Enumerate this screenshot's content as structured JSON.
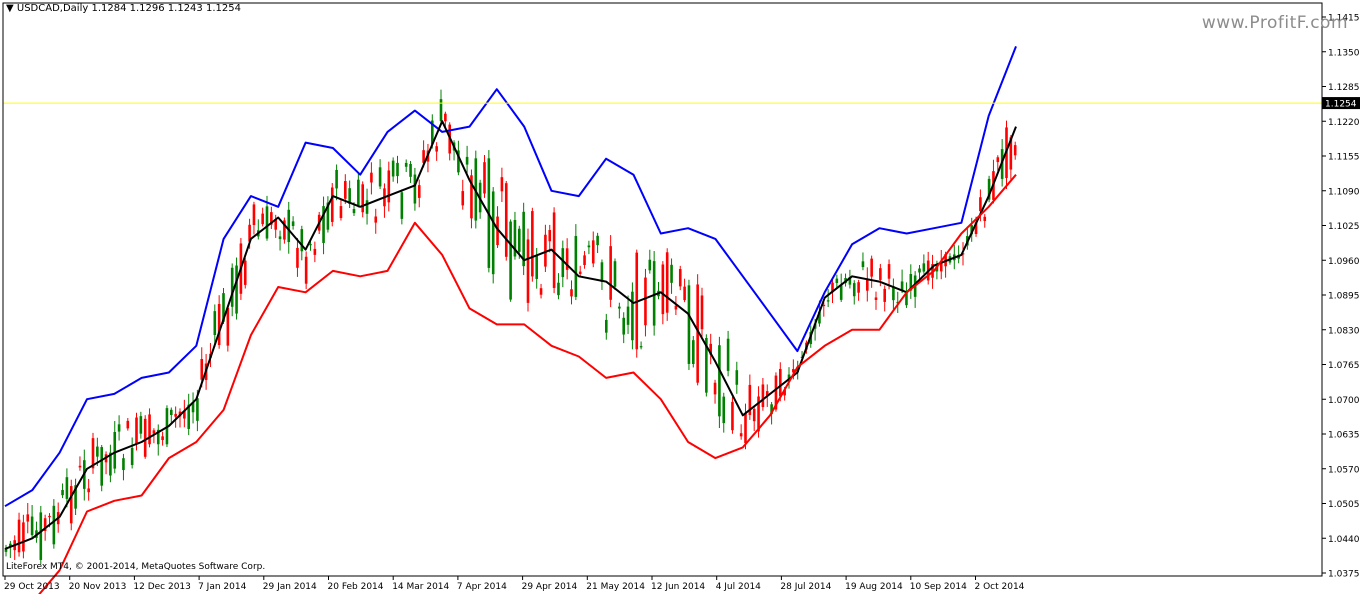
{
  "header": {
    "symbol": "USDCAD,Daily",
    "ohlc": "1.1284 1.1296 1.1243 1.1254"
  },
  "watermark": "www.ProfitF.com",
  "copyright": "LiteForex MT4, © 2001-2014, MetaQuotes Software Corp.",
  "colors": {
    "upper_band": "#0000ff",
    "middle_band": "#000000",
    "lower_band": "#ff0000",
    "bull_candle": "#008000",
    "bear_candle": "#ff0000",
    "bid_line": "#ffff00",
    "price_label_bg": "#000000"
  },
  "chart_data": {
    "type": "candlestick",
    "instrument": "USDCAD",
    "timeframe": "Daily",
    "current_price": 1.1254,
    "current_price_label": "1.1254",
    "ylim": [
      1.0375,
      1.1415
    ],
    "y_ticks": [
      "1.1415",
      "1.1350",
      "1.1285",
      "1.1220",
      "1.1155",
      "1.1090",
      "1.1025",
      "1.0960",
      "1.0895",
      "1.0830",
      "1.0765",
      "1.0700",
      "1.0635",
      "1.0570",
      "1.0505",
      "1.0440",
      "1.0375"
    ],
    "x_tick_labels": [
      "29 Oct 2013",
      "20 Nov 2013",
      "12 Dec 2013",
      "7 Jan 2014",
      "29 Jan 2014",
      "20 Feb 2014",
      "14 Mar 2014",
      "7 Apr 2014",
      "29 Apr 2014",
      "21 May 2014",
      "12 Jun 2014",
      "4 Jul 2014",
      "28 Jul 2014",
      "19 Aug 2014",
      "10 Sep 2014",
      "2 Oct 2014"
    ],
    "indicator": "Bollinger Bands",
    "series": [
      {
        "line": "upper",
        "color": "#0000ff",
        "values": [
          1.05,
          1.053,
          1.06,
          1.07,
          1.071,
          1.074,
          1.075,
          1.08,
          1.1,
          1.108,
          1.106,
          1.118,
          1.117,
          1.112,
          1.12,
          1.124,
          1.12,
          1.121,
          1.128,
          1.121,
          1.109,
          1.108,
          1.115,
          1.112,
          1.101,
          1.102,
          1.1,
          1.093,
          1.086,
          1.079,
          1.09,
          1.099,
          1.102,
          1.101,
          1.102,
          1.103,
          1.123,
          1.136
        ]
      },
      {
        "line": "middle",
        "color": "#000000",
        "values": [
          1.042,
          1.044,
          1.048,
          1.057,
          1.06,
          1.062,
          1.065,
          1.07,
          1.085,
          1.1,
          1.104,
          1.098,
          1.108,
          1.106,
          1.108,
          1.11,
          1.122,
          1.111,
          1.102,
          1.096,
          1.098,
          1.093,
          1.092,
          1.088,
          1.09,
          1.086,
          1.077,
          1.067,
          1.071,
          1.075,
          1.089,
          1.093,
          1.092,
          1.09,
          1.095,
          1.097,
          1.108,
          1.121
        ]
      },
      {
        "line": "lower",
        "color": "#ff0000",
        "values": [
          1.03,
          1.032,
          1.038,
          1.049,
          1.051,
          1.052,
          1.059,
          1.062,
          1.068,
          1.082,
          1.091,
          1.09,
          1.094,
          1.093,
          1.094,
          1.103,
          1.097,
          1.087,
          1.084,
          1.084,
          1.08,
          1.078,
          1.074,
          1.075,
          1.07,
          1.062,
          1.059,
          1.061,
          1.067,
          1.076,
          1.08,
          1.083,
          1.083,
          1.09,
          1.094,
          1.101,
          1.106,
          1.112
        ]
      }
    ]
  }
}
